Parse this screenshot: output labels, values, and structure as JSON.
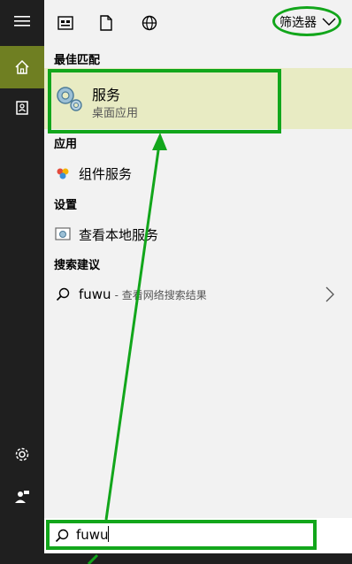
{
  "left_rail": {
    "items": [
      {
        "name": "hamburger-menu-icon"
      },
      {
        "name": "home-icon"
      },
      {
        "name": "notebook-icon"
      },
      {
        "name": "settings-gear-icon"
      },
      {
        "name": "feedback-person-icon"
      }
    ]
  },
  "toolbar": {
    "filter_label": "筛选器",
    "icons": [
      "apps-icon",
      "document-icon",
      "web-globe-icon",
      "chevron-down-icon"
    ]
  },
  "sections": {
    "best_match_header": "最佳匹配",
    "apps_header": "应用",
    "settings_header": "设置",
    "suggestions_header": "搜索建议"
  },
  "best_match": {
    "title": "服务",
    "subtitle": "桌面应用"
  },
  "apps": [
    {
      "label": "组件服务"
    }
  ],
  "settings": [
    {
      "label": "查看本地服务"
    }
  ],
  "suggestions": [
    {
      "query": "fuwu",
      "tail": "- 查看网络搜索结果"
    }
  ],
  "search": {
    "value": "fuwu"
  },
  "colors": {
    "accent": "#6f7f22",
    "highlight_bg": "#e8ebc3",
    "annotation_green": "#12a61b"
  }
}
